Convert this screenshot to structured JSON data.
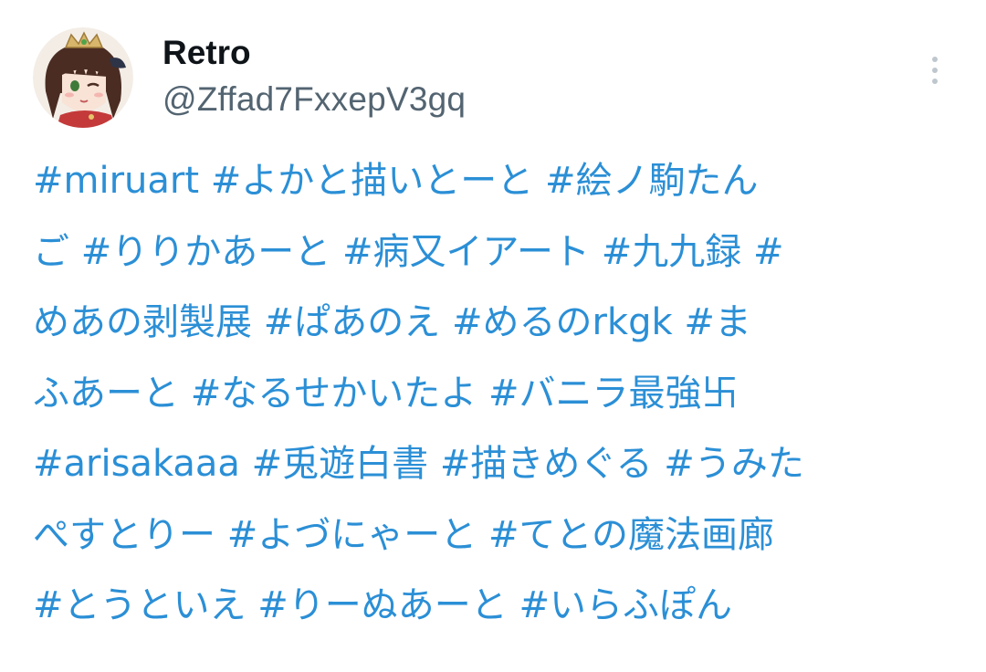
{
  "user": {
    "display_name": "Retro",
    "handle": "@Zffad7FxxepV3gq"
  },
  "menu": {
    "icon": "more-vertical-icon"
  },
  "tweet": {
    "lines": [
      "#miruart #よかと描いとーと #絵ノ駒たん",
      "ご #りりかあーと #病又イアート #九九録 #",
      "めあの剥製展 #ぱあのえ #めるのrkgk #ま",
      "ふあーと #なるせかいたよ #バニラ最強卐",
      "#arisakaaa #兎遊白書 #描きめぐる #うみた",
      "ぺすとりー #よづにゃーと #てとの魔法画廊",
      "#とうといえ #りーぬあーと #いらふぽん"
    ],
    "link_color": "#2b8fd6"
  }
}
